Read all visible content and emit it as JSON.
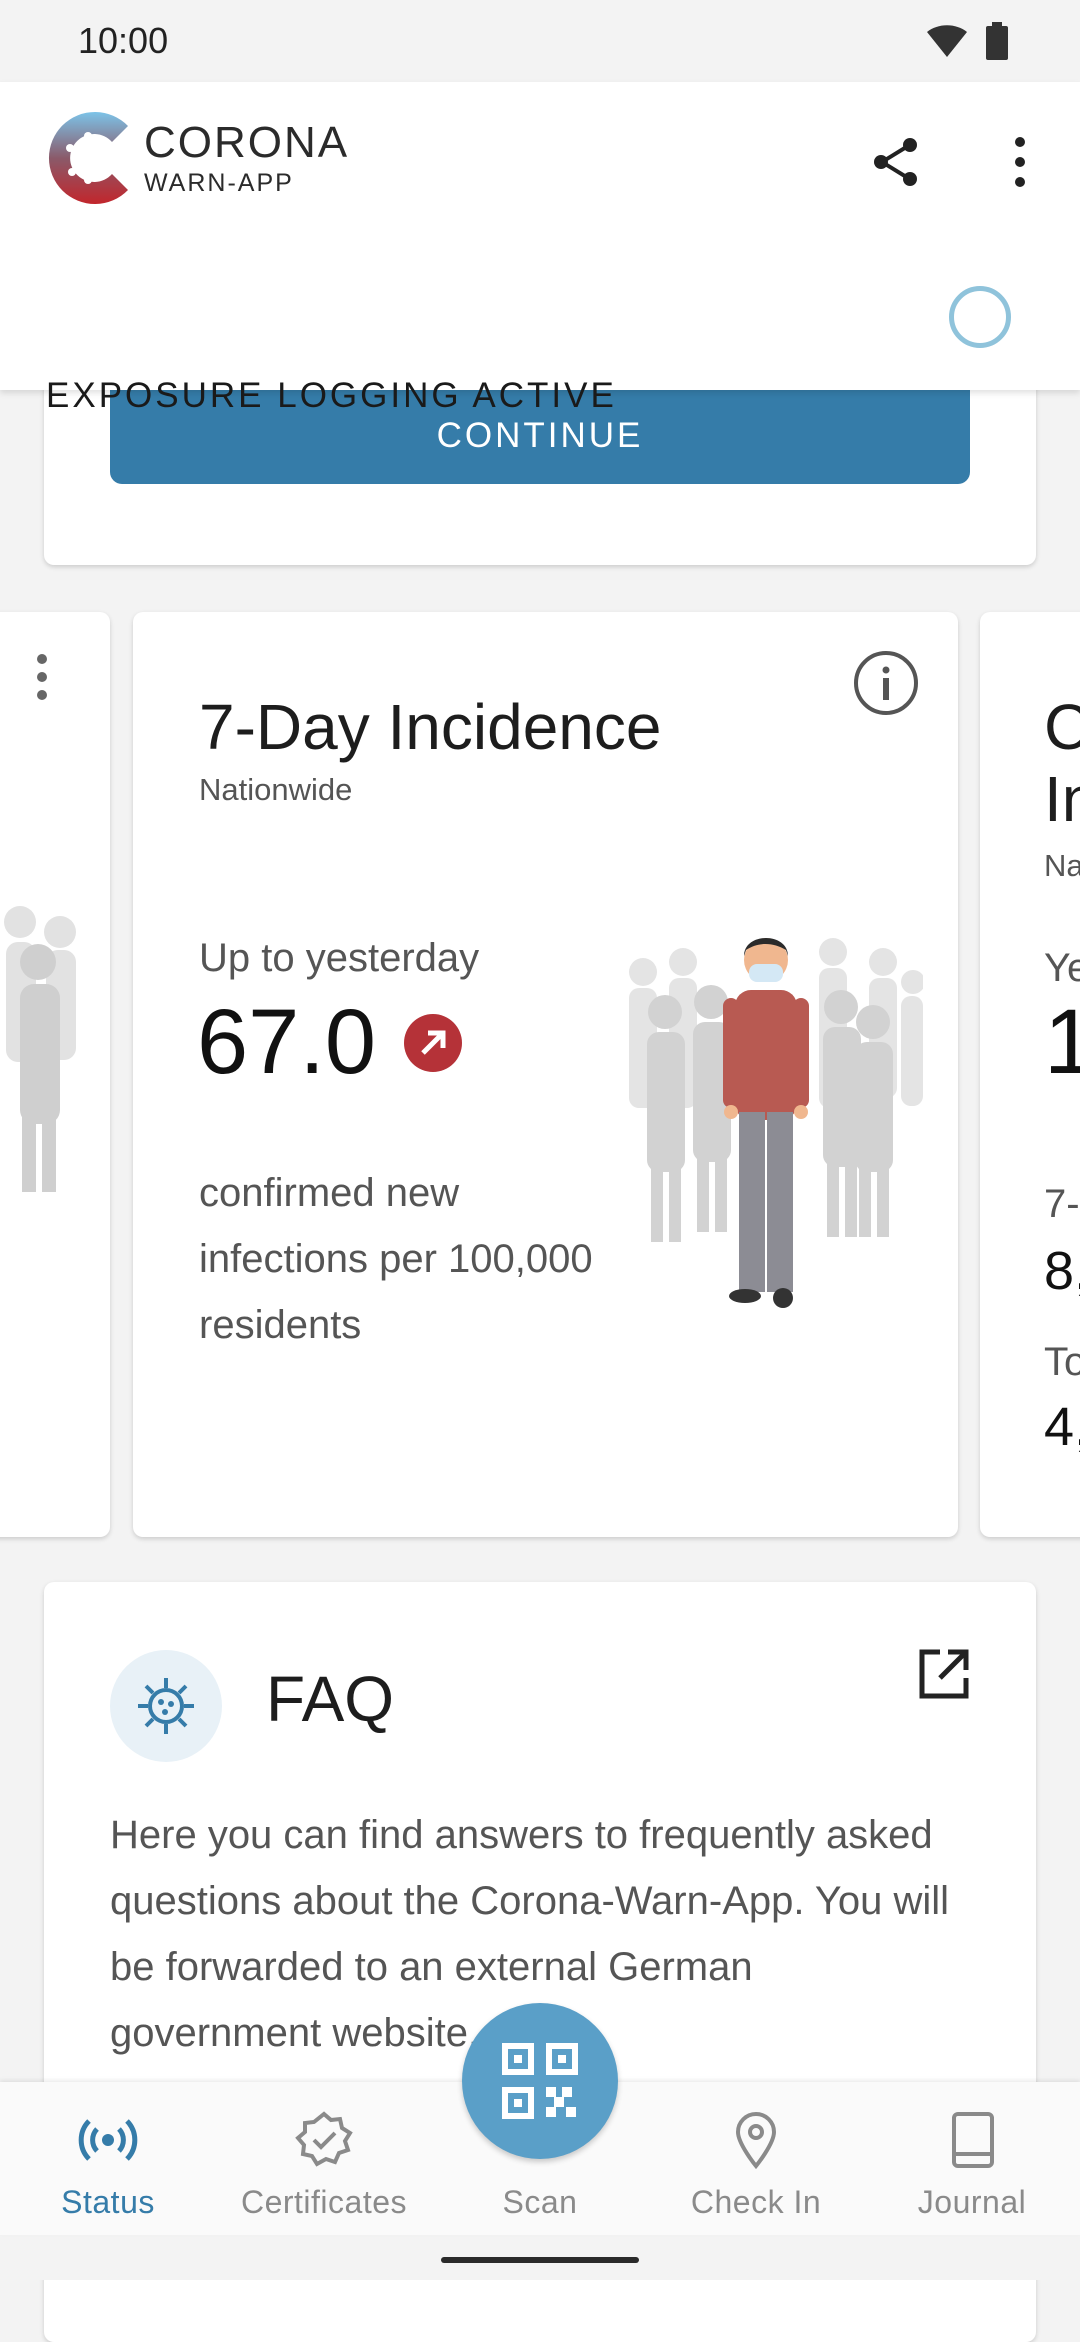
{
  "status_bar": {
    "time": "10:00"
  },
  "app_bar": {
    "logo_line1": "CORONA",
    "logo_line2": "WARN-APP"
  },
  "tracing": {
    "label": "EXPOSURE LOGGING ACTIVE"
  },
  "continue_card": {
    "button_label": "CONTINUE"
  },
  "incidence_card": {
    "title": "7-Day Incidence",
    "subtitle": "Nationwide",
    "period_label": "Up to yesterday",
    "value": "67.0",
    "trend": "increasing",
    "description": "confirmed new infections per 100,000 residents",
    "trend_color": "#b53238"
  },
  "right_card_peek": {
    "title_line1": "C",
    "title_line2": "In",
    "sub": "Na",
    "row1": "Ye",
    "value1": "1",
    "row2": "7-",
    "value2": "8,",
    "row3": "To",
    "value3": "4,"
  },
  "faq_card": {
    "title": "FAQ",
    "text": "Here you can find answers to frequently asked questions about the Corona-Warn-App. You will be forwarded to an external German government website."
  },
  "bottom_nav": {
    "items": [
      {
        "label": "Status",
        "active": true
      },
      {
        "label": "Certificates",
        "active": false
      },
      {
        "label": "Scan",
        "active": false
      },
      {
        "label": "Check In",
        "active": false
      },
      {
        "label": "Journal",
        "active": false
      }
    ]
  },
  "colors": {
    "accent": "#357ca9",
    "fab": "#5a9fc8",
    "tracing_ring": "#8fc3db"
  }
}
